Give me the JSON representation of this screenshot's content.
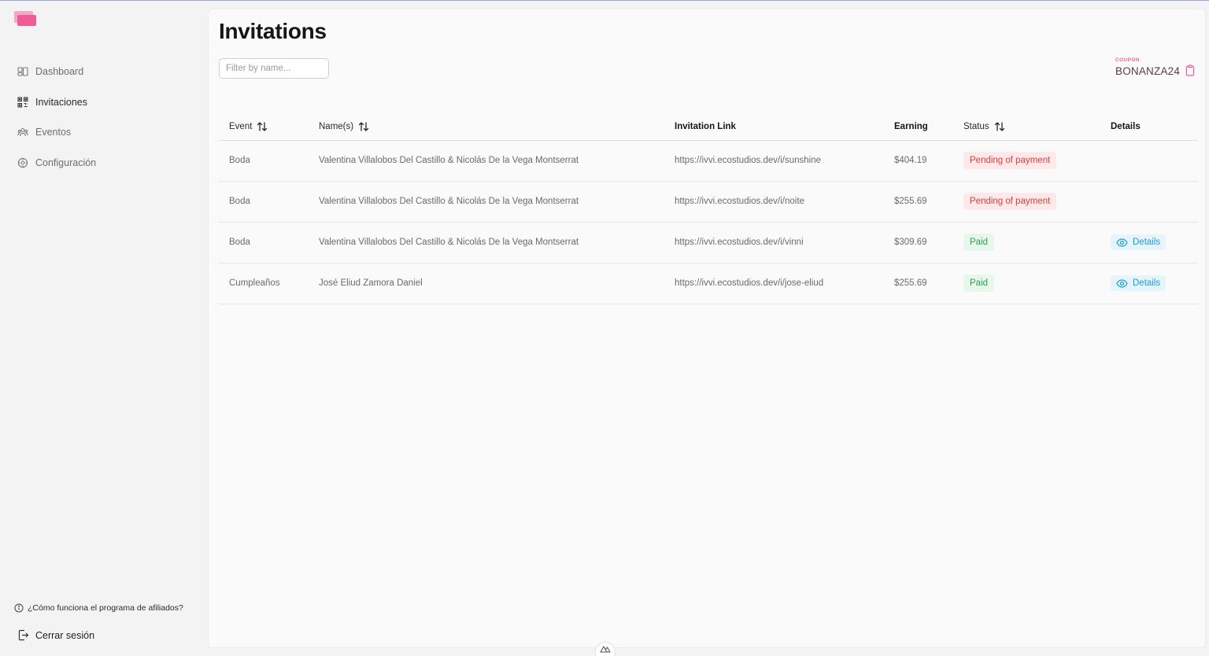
{
  "sidebar": {
    "nav": [
      {
        "label": "Dashboard",
        "icon": "dashboard-icon"
      },
      {
        "label": "Invitaciones",
        "icon": "qr-code-icon"
      },
      {
        "label": "Eventos",
        "icon": "users-icon"
      },
      {
        "label": "Configuración",
        "icon": "settings-icon"
      }
    ],
    "help_label": "¿Cómo funciona el programa de afiliados?",
    "logout_label": "Cerrar sesión"
  },
  "main": {
    "title": "Invitations",
    "filter_placeholder": "Filter by name...",
    "coupon": {
      "label": "COUPON",
      "code": "BONANZA24"
    }
  },
  "table": {
    "headers": {
      "event": "Event",
      "names": "Name(s)",
      "link": "Invitation Link",
      "earning": "Earning",
      "status": "Status",
      "details": "Details"
    },
    "rows": [
      {
        "event": "Boda",
        "names": "Valentina Villalobos Del Castillo & Nicolás De la Vega Montserrat",
        "link": "https://ivvi.ecostudios.dev/i/sunshine",
        "earning": "$404.19",
        "status": "Pending of payment",
        "details": ""
      },
      {
        "event": "Boda",
        "names": "Valentina Villalobos Del Castillo & Nicolás De la Vega Montserrat",
        "link": "https://ivvi.ecostudios.dev/i/noite",
        "earning": "$255.69",
        "status": "Pending of payment",
        "details": ""
      },
      {
        "event": "Boda",
        "names": "Valentina Villalobos Del Castillo & Nicolás De la Vega Montserrat",
        "link": "https://ivvi.ecostudios.dev/i/vinni",
        "earning": "$309.69",
        "status": "Paid",
        "details": "Details"
      },
      {
        "event": "Cumpleaños",
        "names": "José Eliud Zamora Daniel",
        "link": "https://ivvi.ecostudios.dev/i/jose-eliud",
        "earning": "$255.69",
        "status": "Paid",
        "details": "Details"
      }
    ]
  },
  "colors": {
    "brand_pink": "#ee5d98",
    "pending_text": "#dd3d3d",
    "paid_text": "#27a34a",
    "details_blue": "#1c9ad6"
  }
}
